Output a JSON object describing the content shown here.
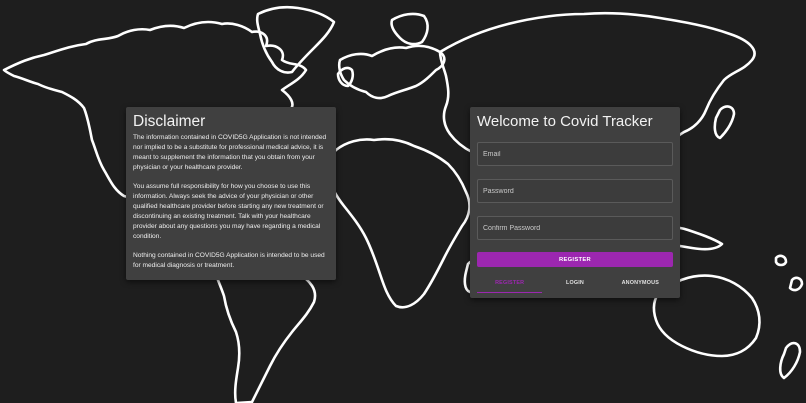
{
  "colors": {
    "background": "#1e1e1e",
    "card": "#404040",
    "accent": "#9c27b0",
    "map_outline": "#ffffff"
  },
  "disclaimer": {
    "title": "Disclaimer",
    "paragraphs": [
      "The information contained in COVID5G Application is not intended nor implied to be a substitute for professional medical advice, it is meant to supplement the information that you obtain from your physician or your healthcare provider.",
      "You assume full responsibility for how you choose to use this information. Always seek the advice of your physician or other qualified healthcare provider before starting any new treatment or discontinuing an existing treatment. Talk with your healthcare provider about any questions you may have regarding a medical condition.",
      "Nothing contained in COVID5G Application is intended to be used for medical diagnosis or treatment."
    ]
  },
  "login": {
    "title": "Welcome to Covid Tracker",
    "email_placeholder": "Email",
    "password_placeholder": "Password",
    "confirm_password_placeholder": "Confirm Password",
    "register_button": "REGISTER",
    "tabs": [
      {
        "label": "REGISTER",
        "active": true
      },
      {
        "label": "LOGIN",
        "active": false
      },
      {
        "label": "ANONYMOUS",
        "active": false
      }
    ]
  }
}
